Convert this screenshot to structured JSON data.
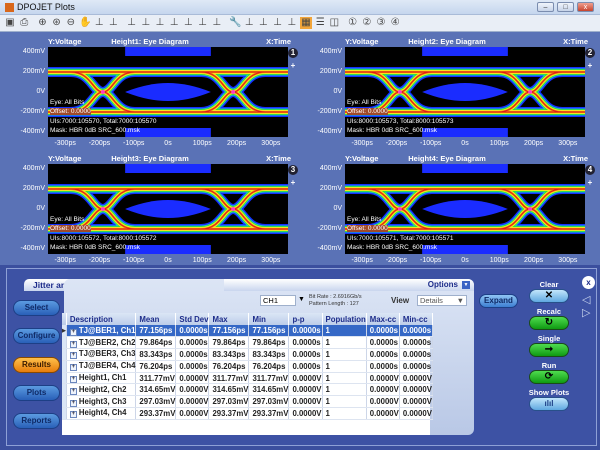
{
  "window": {
    "title": "DPOJET Plots"
  },
  "toolbar": {
    "icons": [
      "save-icon",
      "print-icon",
      "zoom-in-icon",
      "zoom-fit-icon",
      "zoom-out-icon",
      "pan-hand-icon",
      "zoom-region-icon",
      "zoom-region2-icon",
      "cursor-vertical-icon",
      "cursor-horizontal-icon",
      "mask-icon",
      "mask-edit-icon",
      "mask-hits-icon",
      "mask-hits2-icon",
      "mask-margin-icon",
      "settings-wrench-icon",
      "autoscale-icon",
      "marker-icon",
      "baseline-icon",
      "top-icon",
      "layout-grid-icon",
      "layout-stacked-icon",
      "layout-split-icon",
      "plot1-icon",
      "plot2-icon",
      "plot3-icon",
      "plot4-icon"
    ]
  },
  "plots": [
    {
      "ylabel": "Y:Voltage",
      "title": "Height1: Eye Diagram",
      "xlabel": "X:Time",
      "num": "1",
      "eye": "Eye: All Bits",
      "offset": "Offset: 0.0000",
      "uis": "UIs:7000:105570, Total:7000:105570",
      "mask": "Mask: HBR 0dB SRC_600.msk"
    },
    {
      "ylabel": "Y:Voltage",
      "title": "Height2: Eye Diagram",
      "xlabel": "X:Time",
      "num": "2",
      "eye": "Eye: All Bits",
      "offset": "Offset: 0.0000",
      "uis": "UIs:8000:105573, Total:8000:105573",
      "mask": "Mask: HBR 0dB SRC_600.msk"
    },
    {
      "ylabel": "Y:Voltage",
      "title": "Height3: Eye Diagram",
      "xlabel": "X:Time",
      "num": "3",
      "eye": "Eye: All Bits",
      "offset": "Offset: 0.0000",
      "uis": "UIs:8000:105572, Total:8000:105572",
      "mask": "Mask: HBR 0dB SRC_600.msk"
    },
    {
      "ylabel": "Y:Voltage",
      "title": "Height4: Eye Diagram",
      "xlabel": "X:Time",
      "num": "4",
      "eye": "Eye: All Bits",
      "offset": "Offset: 0.0000",
      "uis": "UIs:7000:105571, Total:7000:105571",
      "mask": "Mask: HBR 0dB SRC_600.msk"
    }
  ],
  "yticks": [
    "400mV",
    "200mV",
    "0V",
    "-200mV",
    "-400mV"
  ],
  "xticks": [
    "-300ps",
    "-200ps",
    "-100ps",
    "0s",
    "100ps",
    "200ps",
    "300ps"
  ],
  "panel": {
    "title": "Jitter and Eye Diagram Analysis Tools",
    "options": "Options",
    "source": "CH1",
    "bit_rate": "Bit Rate : 2.6916Gb/s",
    "pattern_length": "Pattern Length : 127",
    "view_label": "View",
    "view_value": "Details",
    "expand": "Expand"
  },
  "nav": [
    "Select",
    "Configure",
    "Results",
    "Plots",
    "Reports"
  ],
  "nav_active": "Results",
  "table": {
    "headers": [
      "Description",
      "Mean",
      "Std Dev",
      "Max",
      "Min",
      "p-p",
      "Population",
      "Max-cc",
      "Min-cc"
    ],
    "rows": [
      [
        "TJ@BER1, Ch1",
        "77.156ps",
        "0.0000s",
        "77.156ps",
        "77.156ps",
        "0.0000s",
        "1",
        "0.0000s",
        "0.0000s"
      ],
      [
        "TJ@BER2, Ch2",
        "79.864ps",
        "0.0000s",
        "79.864ps",
        "79.864ps",
        "0.0000s",
        "1",
        "0.0000s",
        "0.0000s"
      ],
      [
        "TJ@BER3, Ch3",
        "83.343ps",
        "0.0000s",
        "83.343ps",
        "83.343ps",
        "0.0000s",
        "1",
        "0.0000s",
        "0.0000s"
      ],
      [
        "TJ@BER4, Ch4",
        "76.204ps",
        "0.0000s",
        "76.204ps",
        "76.204ps",
        "0.0000s",
        "1",
        "0.0000s",
        "0.0000s"
      ],
      [
        "Height1, Ch1",
        "311.77mV",
        "0.0000V",
        "311.77mV",
        "311.77mV",
        "0.0000V",
        "1",
        "0.0000V",
        "0.0000V"
      ],
      [
        "Height2, Ch2",
        "314.65mV",
        "0.0000V",
        "314.65mV",
        "314.65mV",
        "0.0000V",
        "1",
        "0.0000V",
        "0.0000V"
      ],
      [
        "Height3, Ch3",
        "297.03mV",
        "0.0000V",
        "297.03mV",
        "297.03mV",
        "0.0000V",
        "1",
        "0.0000V",
        "0.0000V"
      ],
      [
        "Height4, Ch4",
        "293.37mV",
        "0.0000V",
        "293.37mV",
        "293.37mV",
        "0.0000V",
        "1",
        "0.0000V",
        "0.0000V"
      ]
    ],
    "selected_row": 0
  },
  "actions": {
    "clear": "Clear",
    "recalc": "Recalc",
    "single": "Single",
    "run": "Run",
    "show_plots": "Show Plots"
  },
  "colors": {
    "accent": "#3568c6",
    "active_nav": "#f0a020",
    "run_green": "#1fb41f"
  }
}
